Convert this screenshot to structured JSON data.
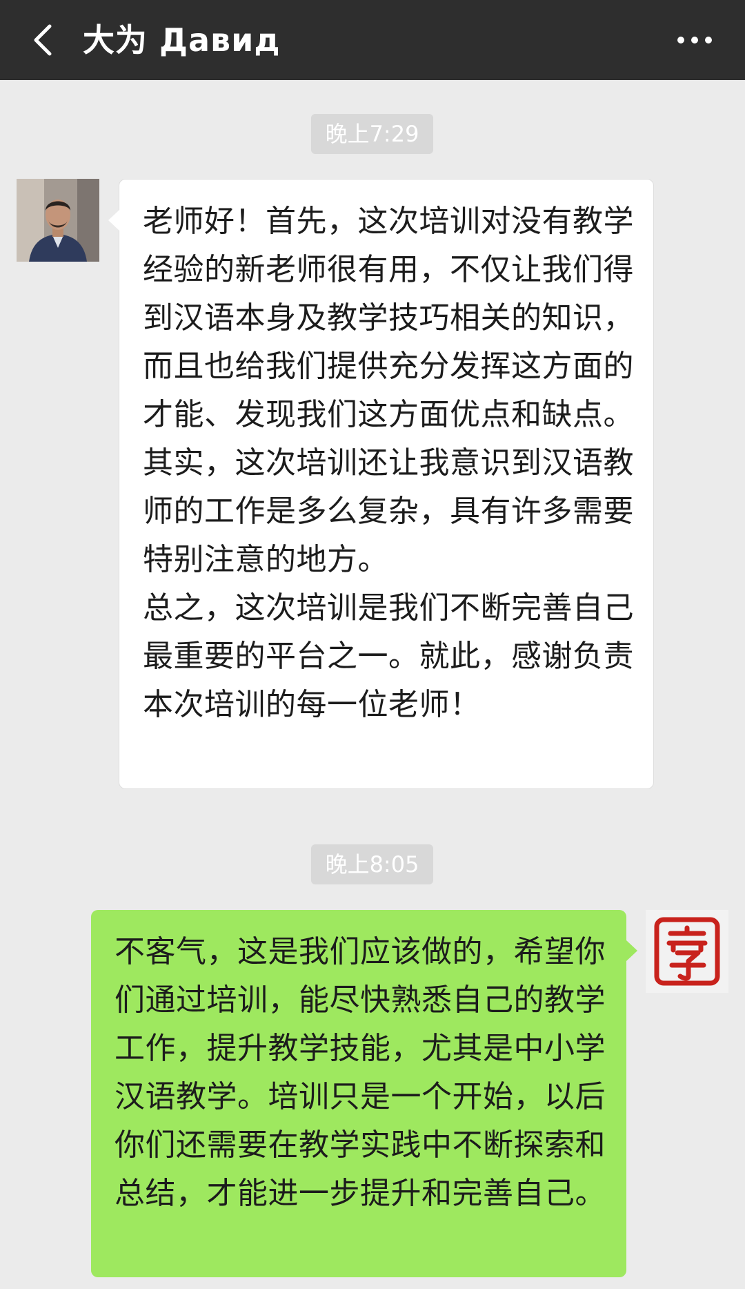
{
  "header": {
    "title": "大为 Давид",
    "back_icon": "chevron-left-icon",
    "more_icon": "ellipsis-icon",
    "background": "#2e2e2e"
  },
  "messages": [
    {
      "time": "晚上7:29",
      "sender": "contact",
      "bubble_color": "#ffffff",
      "paragraphs": [
        "老师好！首先，这次培训对没有教学经验的新老师很有用，不仅让我们得到汉语本身及教学技巧相关的知识，而且也给我们提供充分发挥这方面的才能、发现我们这方面优点和缺点。其实，这次培训还让我意识到汉语教师的工作是多么复杂，具有许多需要特别注意的地方。",
        "总之，这次培训是我们不断完善自己最重要的平台之一。就此，感谢负责本次培训的每一位老师！"
      ]
    },
    {
      "time": "晚上8:05",
      "sender": "me",
      "bubble_color": "#9ee85f",
      "paragraphs": [
        "不客气，这是我们应该做的，希望你们通过培训，能尽快熟悉自己的教学工作，提升教学技能，尤其是中小学汉语教学。培训只是一个开始，以后你们还需要在教学实践中不断探索和总结，才能进一步提升和完善自己。"
      ]
    }
  ]
}
